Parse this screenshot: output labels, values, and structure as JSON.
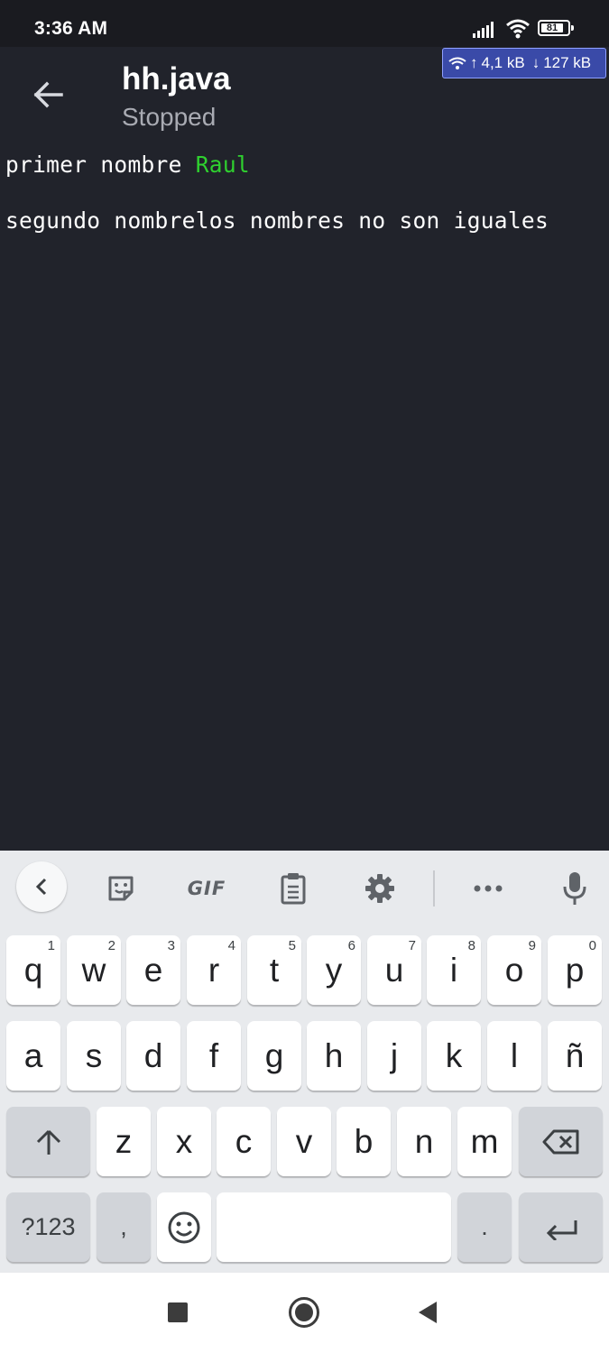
{
  "status_bar": {
    "time": "3:36 AM",
    "battery": "81",
    "net_up": "4,1 kB",
    "net_down": "127 kB",
    "icons": [
      "signal-icon",
      "wifi-icon",
      "battery-icon"
    ]
  },
  "app_bar": {
    "title": "hh.java",
    "status": "Stopped",
    "back_icon": "arrow-left-icon"
  },
  "console": {
    "line1_prompt": "primer nombre ",
    "line1_input": "Raul",
    "line2": "segundo nombrelos nombres no son iguales",
    "input_color": "#2fd12f"
  },
  "keyboard": {
    "toolbar": {
      "gif_label": "GIF",
      "icons": [
        "chevron-left-icon",
        "sticker-icon",
        "clipboard-icon",
        "gear-icon",
        "more-icon",
        "mic-icon"
      ]
    },
    "row1": [
      {
        "label": "q",
        "hint": "1"
      },
      {
        "label": "w",
        "hint": "2"
      },
      {
        "label": "e",
        "hint": "3"
      },
      {
        "label": "r",
        "hint": "4"
      },
      {
        "label": "t",
        "hint": "5"
      },
      {
        "label": "y",
        "hint": "6"
      },
      {
        "label": "u",
        "hint": "7"
      },
      {
        "label": "i",
        "hint": "8"
      },
      {
        "label": "o",
        "hint": "9"
      },
      {
        "label": "p",
        "hint": "0"
      }
    ],
    "row2": [
      "a",
      "s",
      "d",
      "f",
      "g",
      "h",
      "j",
      "k",
      "l",
      "ñ"
    ],
    "row3": [
      "z",
      "x",
      "c",
      "v",
      "b",
      "n",
      "m"
    ],
    "symbols_label": "?123",
    "comma_label": ",",
    "period_label": "."
  },
  "nav_bar": {
    "icons": [
      "recents-icon",
      "home-icon",
      "back-triangle-icon"
    ]
  },
  "colors": {
    "background": "#21232b",
    "status_bar": "#1a1b20",
    "net_badge": "#3a4aa8",
    "keyboard": "#e8eaed"
  }
}
